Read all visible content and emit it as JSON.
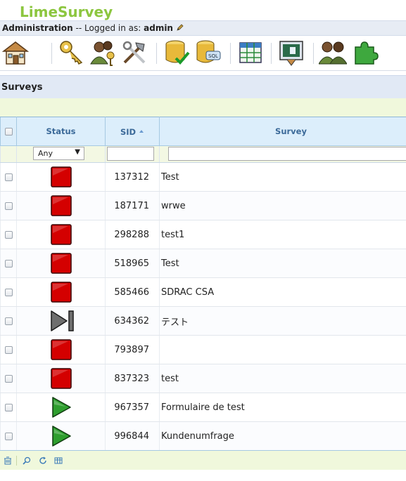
{
  "app": {
    "logo": "LimeSurvey"
  },
  "admin_bar": {
    "title": "Administration",
    "separator": "--",
    "logged_in_text": "Logged in as:",
    "user": "admin"
  },
  "toolbar": {
    "icons": [
      "home-icon",
      "keys-icon",
      "users-icon",
      "tools-icon",
      "database-check-icon",
      "sql-database-icon",
      "table-grid-icon",
      "template-editor-icon",
      "user-groups-icon",
      "plugin-icon"
    ]
  },
  "section": {
    "title": "Surveys"
  },
  "table": {
    "columns": {
      "status": "Status",
      "sid": "SID",
      "survey": "Survey"
    },
    "filter": {
      "status_value": "Any",
      "sid_value": "",
      "survey_value": ""
    },
    "rows": [
      {
        "status": "inactive",
        "sid": "137312",
        "name": "Test"
      },
      {
        "status": "inactive",
        "sid": "187171",
        "name": "wrwe"
      },
      {
        "status": "inactive",
        "sid": "298288",
        "name": "test1"
      },
      {
        "status": "inactive",
        "sid": "518965",
        "name": "Test"
      },
      {
        "status": "inactive",
        "sid": "585466",
        "name": "SDRAC CSA"
      },
      {
        "status": "expired",
        "sid": "634362",
        "name": "テスト"
      },
      {
        "status": "inactive",
        "sid": "793897",
        "name": ""
      },
      {
        "status": "inactive",
        "sid": "837323",
        "name": "test"
      },
      {
        "status": "active",
        "sid": "967357",
        "name": "Formulaire de test"
      },
      {
        "status": "active",
        "sid": "996844",
        "name": "Kundenumfrage"
      }
    ]
  },
  "footer": {
    "icons": [
      "trash-icon",
      "search-icon",
      "refresh-icon",
      "columns-icon"
    ]
  },
  "colors": {
    "logo": "#8cc63f",
    "inactive": "#d40000",
    "active": "#2e9e2e",
    "expired": "#6e6e6e",
    "header_text": "#3c6a99"
  }
}
